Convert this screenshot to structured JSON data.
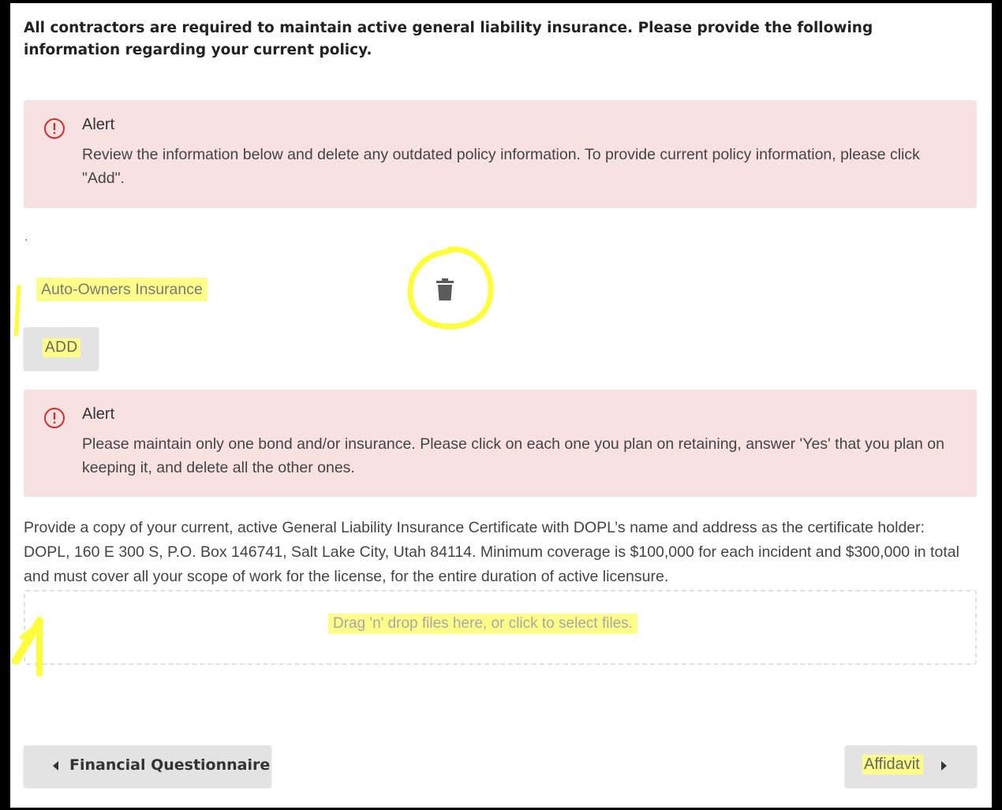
{
  "intro": {
    "text": "All contractors are required to maintain active general liability insurance. Please provide the following information regarding your current policy."
  },
  "alerts": [
    {
      "title": "Alert",
      "body": "Review the information below and delete any outdated policy information. To provide current policy information, please click \"Add\".",
      "icon": "exclamation-circle-icon"
    },
    {
      "title": "Alert",
      "body": "Please maintain only one bond and/or insurance. Please click on each one you plan on retaining, answer 'Yes' that you plan on keeping it, and delete all the other ones.",
      "icon": "exclamation-circle-icon"
    }
  ],
  "policy_list": {
    "separator": ".",
    "items": [
      {
        "name": "Auto-Owners Insurance",
        "action_icon": "trash-icon"
      }
    ]
  },
  "add_button": {
    "label": "ADD"
  },
  "certificate": {
    "instructions": "Provide a copy of your current, active General Liability Insurance Certificate with DOPL’s name and address as the certificate holder: DOPL, 160 E 300 S, P.O. Box 146741, Salt Lake City, Utah 84114. Minimum coverage is $100,000 for each incident and $300,000 in total and must cover all your scope of work for the license, for the entire duration of active licensure.",
    "dropzone_text": "Drag 'n' drop files here, or click to select files."
  },
  "navigation": {
    "prev_label": "Financial Questionnaire",
    "next_label": "Affidavit"
  },
  "colors": {
    "alert_background": "#f8e1e1",
    "alert_icon": "#d32f2f",
    "highlight": "#fdfd8a",
    "button_background": "#e3e3e3"
  }
}
